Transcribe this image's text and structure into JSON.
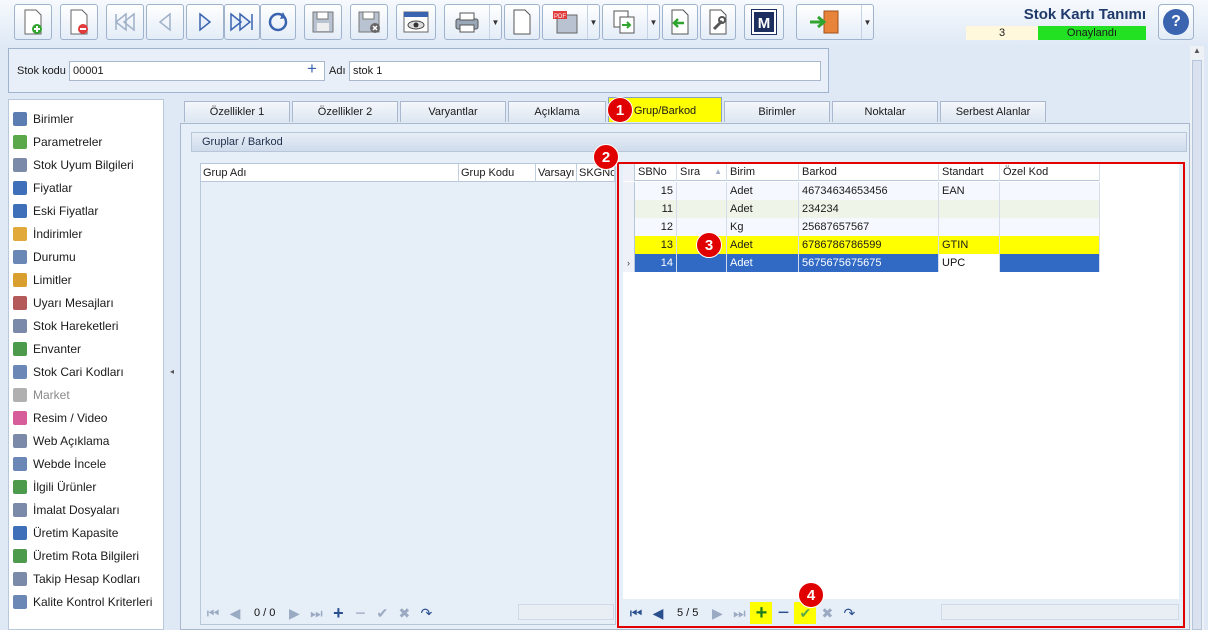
{
  "app": {
    "title": "Stok Kartı Tanımı",
    "status_number": "3",
    "status_text": "Onaylandı",
    "help_label": "?"
  },
  "toolbar": {
    "buttons": [
      {
        "icon": "new-document-icon"
      },
      {
        "icon": "delete-document-icon"
      },
      {
        "icon": "first-record-icon"
      },
      {
        "icon": "previous-record-icon"
      },
      {
        "icon": "next-record-icon"
      },
      {
        "icon": "last-record-icon"
      },
      {
        "icon": "refresh-icon"
      },
      {
        "icon": "save-icon"
      },
      {
        "icon": "save-cancel-icon"
      },
      {
        "icon": "preview-icon"
      },
      {
        "icon": "print-icon"
      },
      {
        "icon": "blank-page-icon"
      },
      {
        "icon": "pdf-save-icon"
      },
      {
        "icon": "copy-icon"
      },
      {
        "icon": "import-icon"
      },
      {
        "icon": "tools-icon"
      },
      {
        "icon": "m-logo-icon",
        "label": "M"
      },
      {
        "icon": "exit-icon"
      }
    ]
  },
  "form": {
    "stok_kodu_label": "Stok kodu",
    "stok_kodu_value": "00001",
    "adi_label": "Adı",
    "adi_value": "stok 1"
  },
  "sidebar": {
    "items": [
      {
        "label": "Birimler",
        "color": "#5b7db1"
      },
      {
        "label": "Parametreler",
        "color": "#5aa84a"
      },
      {
        "label": "Stok Uyum Bilgileri",
        "color": "#7a8aa8"
      },
      {
        "label": "Fiyatlar",
        "color": "#3e6fb8"
      },
      {
        "label": "Eski Fiyatlar",
        "color": "#3e6fb8"
      },
      {
        "label": "İndirimler",
        "color": "#e0a93a"
      },
      {
        "label": "Durumu",
        "color": "#6b87b5"
      },
      {
        "label": "Limitler",
        "color": "#d9a02f"
      },
      {
        "label": "Uyarı Mesajları",
        "color": "#b55a5a"
      },
      {
        "label": "Stok Hareketleri",
        "color": "#7a8aa8"
      },
      {
        "label": "Envanter",
        "color": "#4d9a4d"
      },
      {
        "label": "Stok Cari Kodları",
        "color": "#6b87b5"
      },
      {
        "label": "Market",
        "color": "#b0b0b0",
        "disabled": true
      },
      {
        "label": "Resim / Video",
        "color": "#d65c9a"
      },
      {
        "label": "Web Açıklama",
        "color": "#7a8aa8"
      },
      {
        "label": "Webde İncele",
        "color": "#6b87b5"
      },
      {
        "label": "İlgili Ürünler",
        "color": "#4d9a4d"
      },
      {
        "label": "İmalat Dosyaları",
        "color": "#7a8aa8"
      },
      {
        "label": "Üretim Kapasite",
        "color": "#3e6fb8"
      },
      {
        "label": "Üretim Rota Bilgileri",
        "color": "#4d9a4d"
      },
      {
        "label": "Takip Hesap Kodları",
        "color": "#7a8aa8"
      },
      {
        "label": "Kalite Kontrol Kriterleri",
        "color": "#6b87b5"
      }
    ]
  },
  "tabs": [
    {
      "label": "Özellikler 1"
    },
    {
      "label": "Özellikler 2"
    },
    {
      "label": "Varyantlar"
    },
    {
      "label": "Açıklama"
    },
    {
      "label": "Grup/Barkod",
      "active": true
    },
    {
      "label": "Birimler"
    },
    {
      "label": "Noktalar"
    },
    {
      "label": "Serbest Alanlar"
    }
  ],
  "group_panel": {
    "title": "Gruplar / Barkod"
  },
  "left_grid": {
    "columns": [
      "Grup Adı",
      "Grup Kodu",
      "Varsayı",
      "SKGNo"
    ],
    "nav_count": "0 / 0"
  },
  "right_grid": {
    "columns": [
      "SBNo",
      "Sıra",
      "Birim",
      "Barkod",
      "Standart",
      "Özel Kod"
    ],
    "rows": [
      {
        "sbno": "15",
        "sira": "",
        "birim": "Adet",
        "barkod": "46734634653456",
        "standart": "EAN",
        "ozel": ""
      },
      {
        "sbno": "11",
        "sira": "",
        "birim": "Adet",
        "barkod": "234234",
        "standart": "",
        "ozel": ""
      },
      {
        "sbno": "12",
        "sira": "",
        "birim": "Kg",
        "barkod": "25687657567",
        "standart": "",
        "ozel": ""
      },
      {
        "sbno": "13",
        "sira": "",
        "birim": "Adet",
        "barkod": "6786786786599",
        "standart": "GTIN",
        "ozel": ""
      },
      {
        "sbno": "14",
        "sira": "",
        "birim": "Adet",
        "barkod": "5675675675675",
        "standart": "UPC",
        "ozel": ""
      }
    ],
    "nav_count": "5 / 5"
  },
  "badges": [
    "1",
    "2",
    "3",
    "4"
  ],
  "colors": {
    "highlight": "#ffff00",
    "selection": "#316ac5",
    "annotation_red": "#e00000",
    "status_green": "#22e022"
  }
}
